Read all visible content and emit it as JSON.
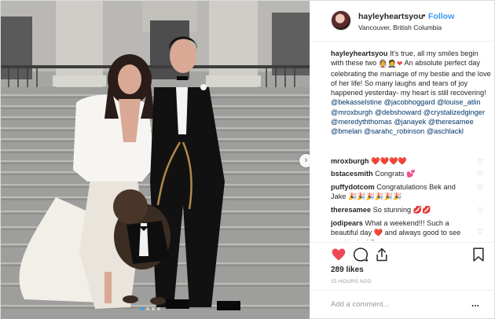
{
  "header": {
    "username": "hayleyheartsyou",
    "separator": "•",
    "follow_label": "Follow",
    "location": "Vancouver, British Columbia"
  },
  "caption": {
    "username": "hayleyheartsyou",
    "text_1": "It's true, all my smiles begin with these two",
    "text_2": "An absolute perfect day celebrating the marriage of my bestie and the love of her life! So many laughs and tears of joy happened yesterday- my heart is still recovering!",
    "mentions": [
      "@bekasselstine",
      "@jacobhoggard",
      "@louise_atlin",
      "@mroxburgh",
      "@debshoward",
      "@crystalizedginger",
      "@meredyththomas",
      "@janayek",
      "@theresamee",
      "@bmelan",
      "@sarahc_robinson",
      "@aschlackl"
    ]
  },
  "comments": [
    {
      "username": "mroxburgh",
      "text": "❤️❤️❤️❤️"
    },
    {
      "username": "bstacesmith",
      "text": "Congrats 💕"
    },
    {
      "username": "puffydotcom",
      "text": "Congratulations Bek and Jake 🎉🎉🎉🎉🎉🎉"
    },
    {
      "username": "theresamee",
      "text": "So stunning 💋💋"
    },
    {
      "username": "jodipears",
      "text": "What a weekend!!! Such a beautiful day ❤️ and always good to see you Hayley! Pretty mama ♥"
    }
  ],
  "likes_label": "289 likes",
  "time_ago": "15 HOURS AGO",
  "add_comment_placeholder": "Add a comment...",
  "more_label": "...",
  "next_arrow": "›",
  "colors": {
    "accent": "#3897f0",
    "heart": "#ed4956",
    "text": "#262626",
    "muted": "#999999"
  },
  "icons": [
    "heart-icon",
    "comment-icon",
    "share-icon",
    "bookmark-icon",
    "chevron-right-icon",
    "small-heart-icon"
  ]
}
